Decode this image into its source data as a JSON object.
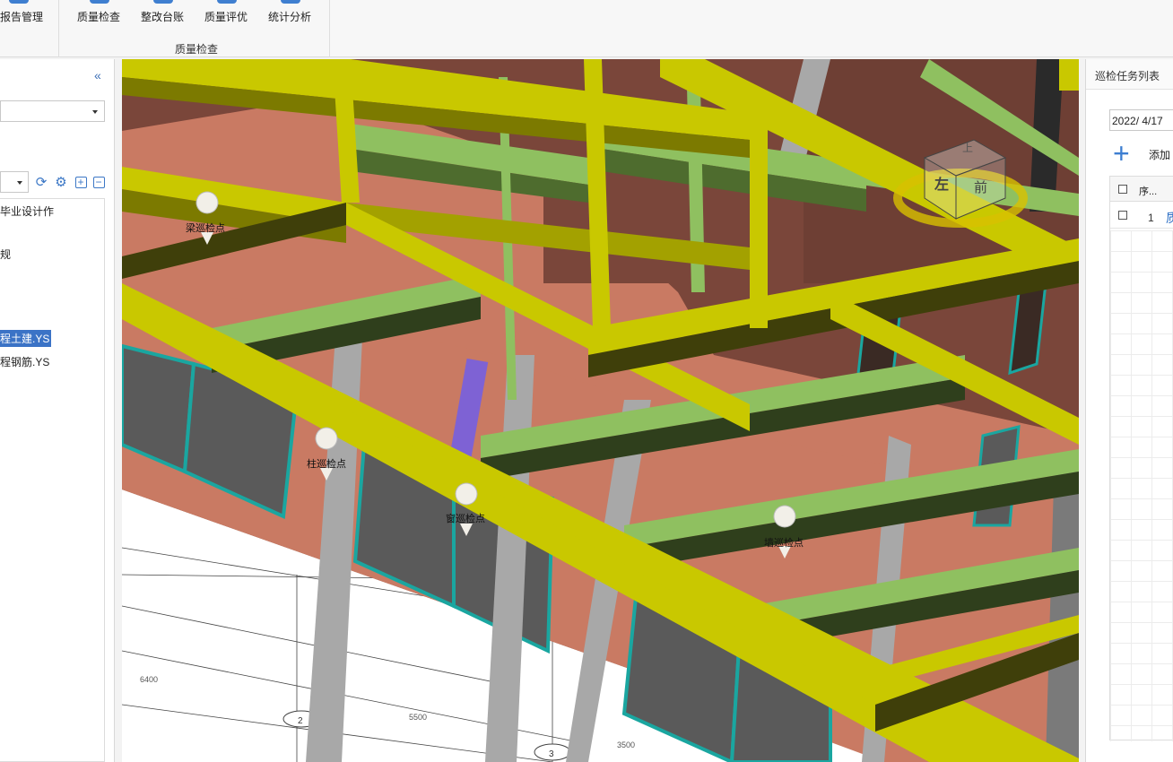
{
  "ribbon": {
    "buttons": [
      {
        "label": "报告管理",
        "icon": "report-icon"
      },
      {
        "label": "质量检查",
        "icon": "quality-check-icon"
      },
      {
        "label": "整改台账",
        "icon": "rectification-ledger-icon"
      },
      {
        "label": "质量评优",
        "icon": "quality-award-icon"
      },
      {
        "label": "统计分析",
        "icon": "statistics-icon"
      }
    ],
    "group_label": "质量检查"
  },
  "left_panel": {
    "collapse_icon": "double-chevron-left-icon",
    "collapse_glyph": "«",
    "toolbar_icons": [
      "refresh-icon",
      "settings-icon",
      "expand-all-icon",
      "collapse-all-icon"
    ],
    "tree_items": [
      {
        "label": "毕业设计作",
        "selected": false
      },
      {
        "label": "规",
        "selected": false
      },
      {
        "label": "程土建.YS",
        "selected": true
      },
      {
        "label": "程钢筋.YS",
        "selected": false
      }
    ]
  },
  "viewport": {
    "markers": [
      {
        "label": "梁巡检点"
      },
      {
        "label": "柱巡检点"
      },
      {
        "label": "窗巡检点"
      },
      {
        "label": "墙巡检点"
      }
    ],
    "view_cube": {
      "face_top": "上",
      "face_left": "左",
      "face_front": "前"
    },
    "dimensions": [
      "6400",
      "5500",
      "3500"
    ],
    "axis_labels": [
      "2",
      "3"
    ],
    "colors": {
      "beam_yellow": "#c9c800",
      "beam_green": "#8fc060",
      "wall_red": "#c97a63",
      "wall_dark": "#7a463a",
      "window_dark": "#5a5a5a",
      "window_frame": "#1aa6a0",
      "column_gray": "#a8a8a8"
    }
  },
  "right_panel": {
    "title": "巡检任务列表",
    "date_value": "2022/  4/17",
    "add_label": "添加",
    "add_icon": "plus-icon",
    "table": {
      "col_seq": "序...",
      "rows": [
        {
          "num": "1",
          "link": "质"
        }
      ]
    }
  }
}
